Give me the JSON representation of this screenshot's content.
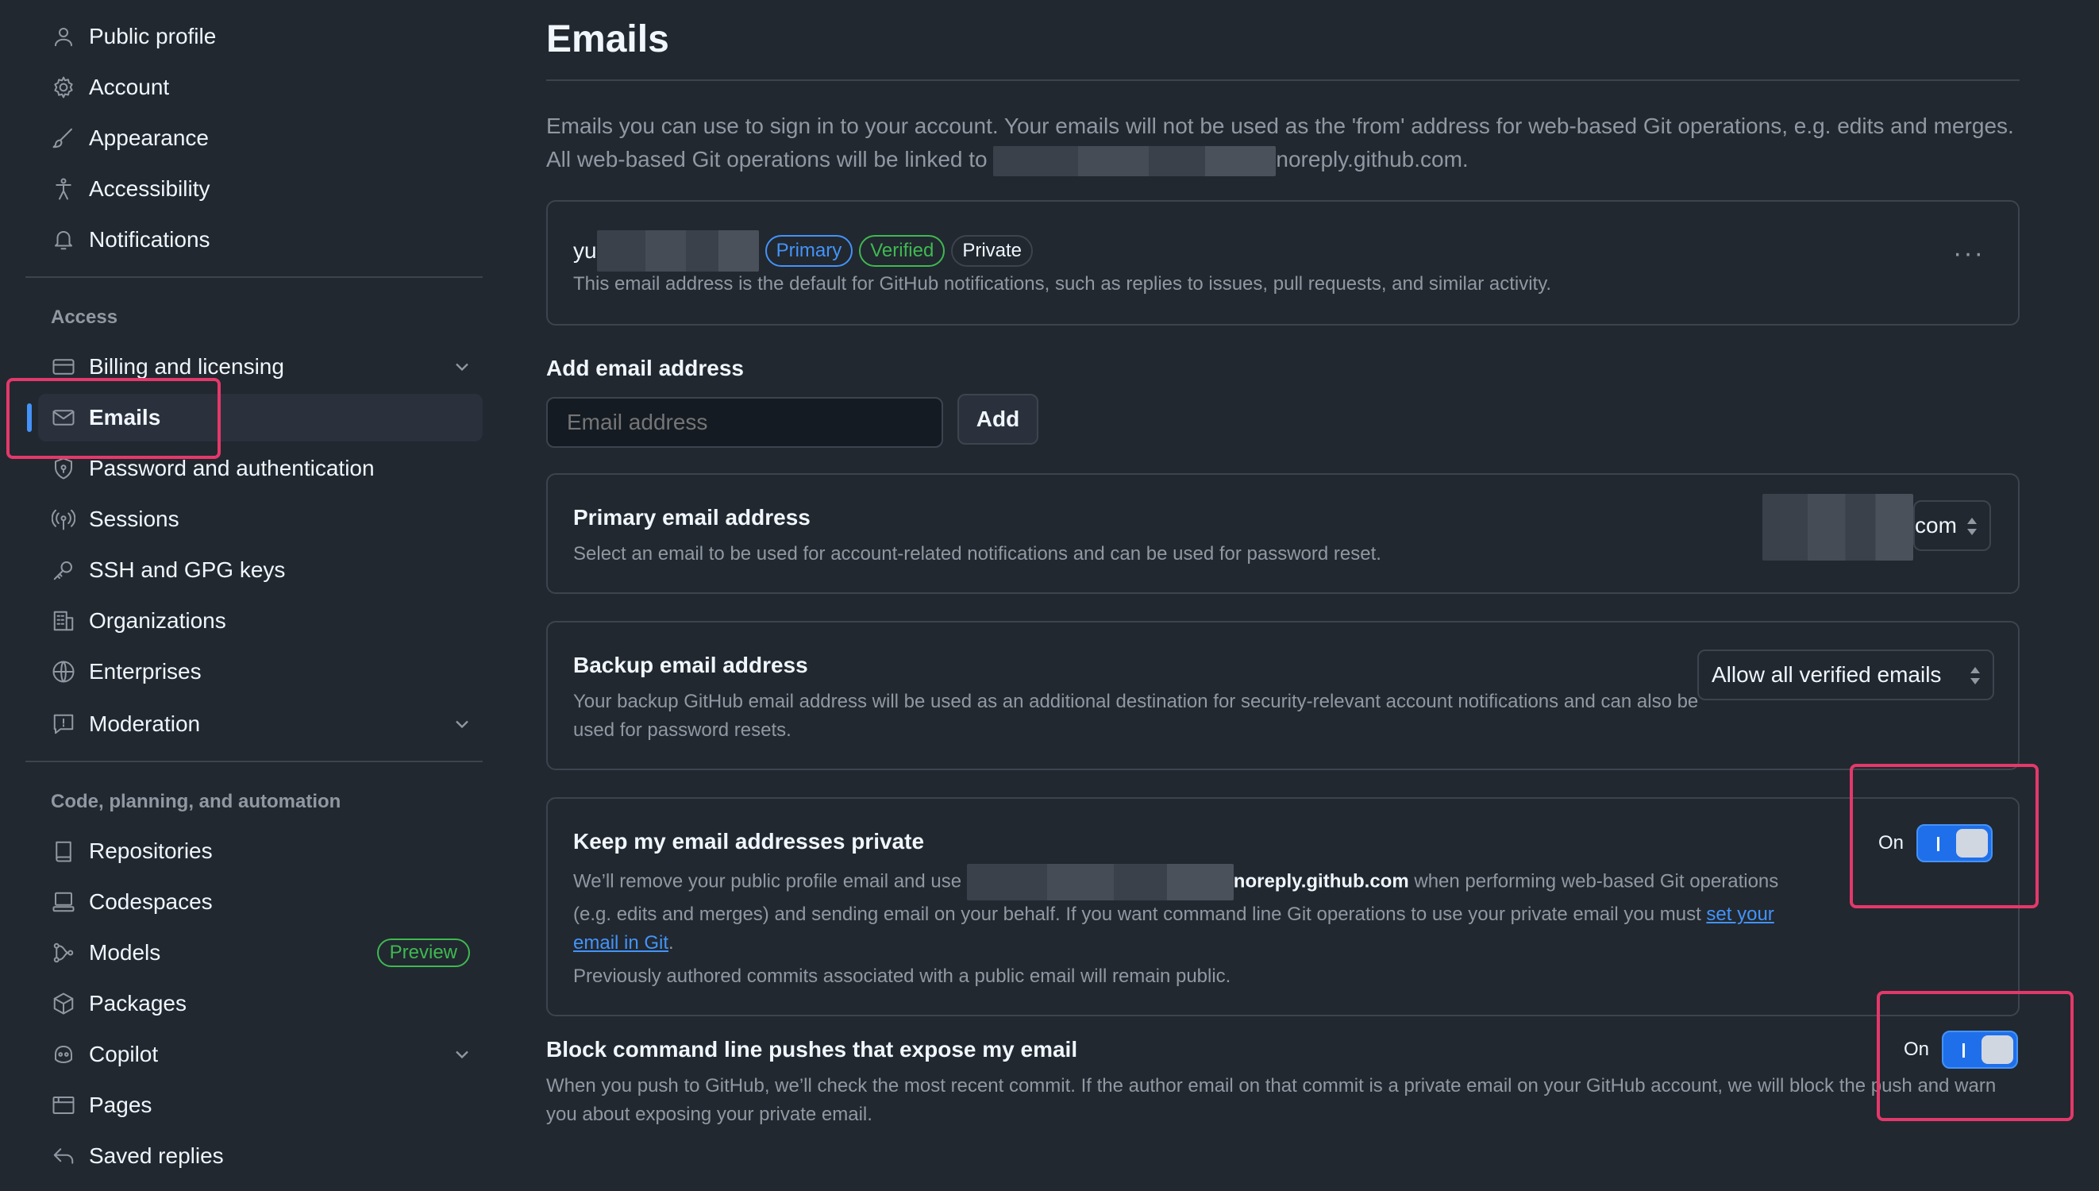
{
  "sidebar": {
    "items_top": [
      {
        "label": "Public profile",
        "icon": "person-icon"
      },
      {
        "label": "Account",
        "icon": "gear-icon"
      },
      {
        "label": "Appearance",
        "icon": "paintbrush-icon"
      },
      {
        "label": "Accessibility",
        "icon": "accessibility-icon"
      },
      {
        "label": "Notifications",
        "icon": "bell-icon"
      }
    ],
    "access_heading": "Access",
    "items_access": [
      {
        "label": "Billing and licensing",
        "icon": "credit-card-icon",
        "expandable": true
      },
      {
        "label": "Emails",
        "icon": "mail-icon",
        "active": true
      },
      {
        "label": "Password and authentication",
        "icon": "shield-lock-icon"
      },
      {
        "label": "Sessions",
        "icon": "broadcast-icon"
      },
      {
        "label": "SSH and GPG keys",
        "icon": "key-icon"
      },
      {
        "label": "Organizations",
        "icon": "organization-icon"
      },
      {
        "label": "Enterprises",
        "icon": "globe-icon"
      },
      {
        "label": "Moderation",
        "icon": "report-icon",
        "expandable": true
      }
    ],
    "code_heading": "Code, planning, and automation",
    "items_code": [
      {
        "label": "Repositories",
        "icon": "repo-icon"
      },
      {
        "label": "Codespaces",
        "icon": "codespaces-icon"
      },
      {
        "label": "Models",
        "icon": "models-icon",
        "badge": "Preview"
      },
      {
        "label": "Packages",
        "icon": "package-icon"
      },
      {
        "label": "Copilot",
        "icon": "copilot-icon",
        "expandable": true
      },
      {
        "label": "Pages",
        "icon": "browser-icon"
      },
      {
        "label": "Saved replies",
        "icon": "reply-icon"
      }
    ]
  },
  "main": {
    "title": "Emails",
    "intro_part1": "Emails you can use to sign in to your account. Your emails will not be used as the 'from' address for web-based Git operations, e.g. edits and merges. All web-based Git operations will be linked to ",
    "intro_part2": "noreply.github.com.",
    "email_entry": {
      "prefix": "yu",
      "badges": {
        "primary": "Primary",
        "verified": "Verified",
        "private": "Private"
      },
      "description": "This email address is the default for GitHub notifications, such as replies to issues, pull requests, and similar activity.",
      "menu": "···"
    },
    "add_email": {
      "label": "Add email address",
      "placeholder": "Email address",
      "button": "Add"
    },
    "primary_email": {
      "title": "Primary email address",
      "description": "Select an email to be used for account-related notifications and can be used for password reset.",
      "selected_suffix": "com"
    },
    "backup_email": {
      "title": "Backup email address",
      "description": "Your backup GitHub email address will be used as an additional destination for security-relevant account notifications and can also be used for password resets.",
      "selected": "Allow all verified emails"
    },
    "keep_private": {
      "title": "Keep my email addresses private",
      "desc_a": "We’ll remove your public profile email and use ",
      "desc_b": "noreply.github.com",
      "desc_c": " when performing web-based Git operations (e.g. edits and merges) and sending email on your behalf. If you want command line Git operations to use your private email you must ",
      "link": "set your email in Git",
      "desc_d": ".",
      "note": "Previously authored commits associated with a public email will remain public.",
      "toggle_label": "On"
    },
    "block_push": {
      "title": "Block command line pushes that expose my email",
      "description": "When you push to GitHub, we’ll check the most recent commit. If the author email on that commit is a private email on your GitHub account, we will block the push and warn you about exposing your private email.",
      "toggle_label": "On"
    }
  },
  "colors": {
    "background": "#212830",
    "accent": "#4493f8",
    "success": "#3fb950",
    "highlight": "#e5386a"
  }
}
